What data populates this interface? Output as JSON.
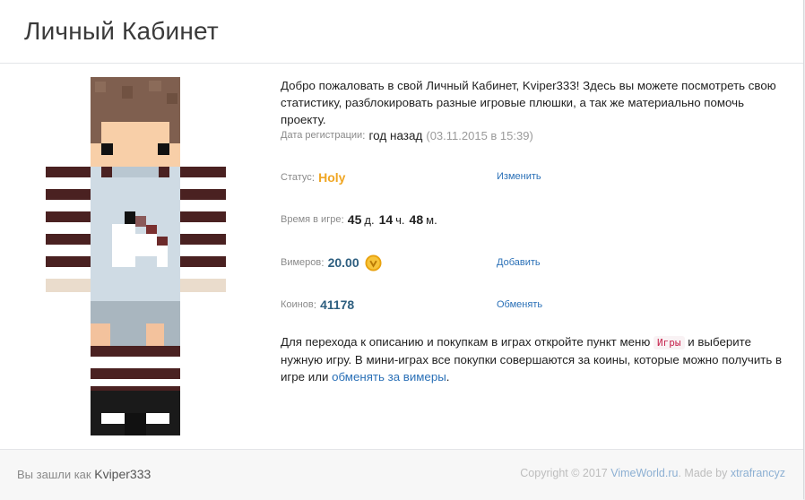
{
  "header": {
    "title": "Личный Кабинет"
  },
  "profile": {
    "intro": "Добро пожаловать в свой Личный Кабинет, Kviper333! Здесь вы можете посмотреть свою статистику, разблокировать разные игровые плюшки, а так же материально помочь проекту.",
    "registration": {
      "label": "Дата регистрации",
      "value": "год назад",
      "date": "(03.11.2015 в 15:39)"
    },
    "status": {
      "label": "Статус",
      "value": "Holy",
      "action": "Изменить"
    },
    "playtime": {
      "label": "Время в игре",
      "days": "45",
      "days_unit": "д.",
      "hours": "14",
      "hours_unit": "ч.",
      "minutes": "48",
      "minutes_unit": "м."
    },
    "vimers": {
      "label": "Вимеров",
      "value": "20.00",
      "action": "Добавить",
      "icon": "coin-icon"
    },
    "coins": {
      "label": "Коинов",
      "value": "41178",
      "action": "Обменять"
    },
    "info_part1": "Для перехода к описанию и покупкам в играх откройте пункт меню",
    "info_code": "Игры",
    "info_part2": "и выберите нужную игру. В мини-играх все покупки совершаются за коины, которые можно получить в игре или",
    "info_link": "обменять за вимеры",
    "info_end": "."
  },
  "footer": {
    "login_prefix": "Вы зашли как",
    "username": "Kviper333",
    "copyright_prefix": "Copyright © 2017",
    "site_link": "VimeWorld.ru",
    "made_by_prefix": ". Made by",
    "author_link": "xtrafrancyz"
  },
  "colors": {
    "status": "#f0a623",
    "link": "#2a70b7",
    "value_blue": "#2e5f80"
  }
}
